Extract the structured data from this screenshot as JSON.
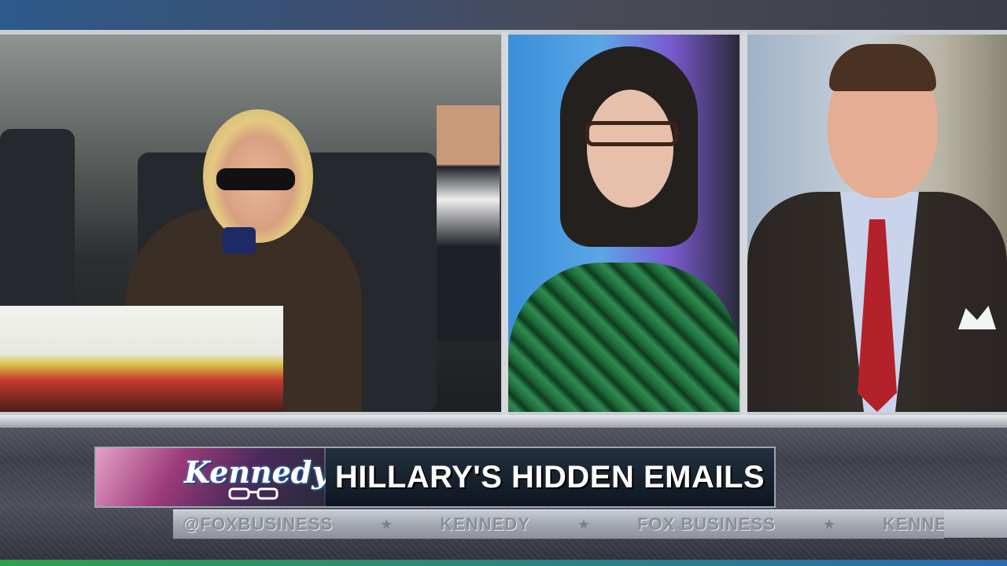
{
  "broadcast": {
    "show_logo": "Kennedy",
    "headline": "HILLARY'S HIDDEN EMAILS",
    "ticker": [
      "@FOXBUSINESS",
      "KENNEDY",
      "FOX BUSINESS",
      "KENNEDY"
    ]
  },
  "panels": [
    {
      "name": "photo-hillary-plane"
    },
    {
      "name": "host-kennedy"
    },
    {
      "name": "guest-commentator"
    }
  ],
  "colors": {
    "banner_bg": "#0d1620",
    "logo_accent": "#9b3a78",
    "tie_red": "#b3222a",
    "dress_green": "#2f8a50"
  }
}
